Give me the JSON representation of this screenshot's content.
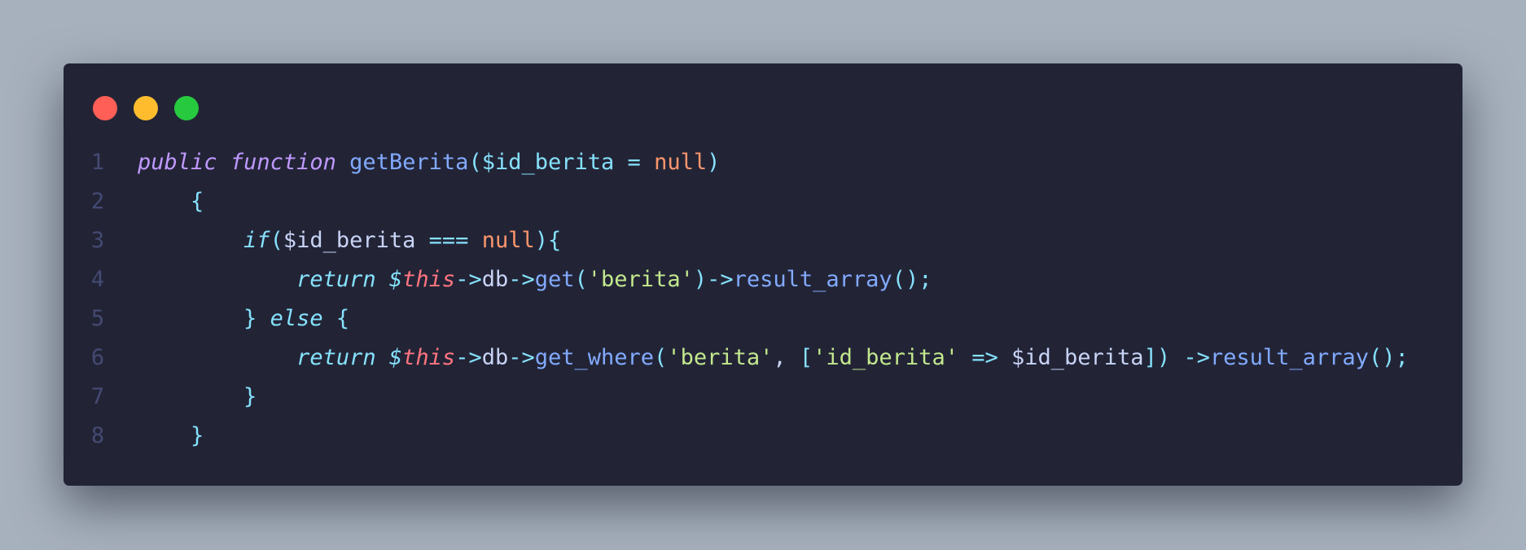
{
  "window": {
    "colors": {
      "close": "#ff5f56",
      "minimize": "#ffbd2e",
      "maximize": "#27c93f",
      "background": "#222436"
    }
  },
  "code": {
    "lines": [
      {
        "number": "1",
        "indent": 0,
        "tokens": [
          {
            "t": "public",
            "c": "kw"
          },
          {
            "t": " ",
            "c": "plain"
          },
          {
            "t": "function",
            "c": "kw"
          },
          {
            "t": " ",
            "c": "plain"
          },
          {
            "t": "getBerita",
            "c": "fn"
          },
          {
            "t": "(",
            "c": "punc"
          },
          {
            "t": "$id_berita",
            "c": "var"
          },
          {
            "t": " ",
            "c": "plain"
          },
          {
            "t": "=",
            "c": "op"
          },
          {
            "t": " ",
            "c": "plain"
          },
          {
            "t": "null",
            "c": "nul"
          },
          {
            "t": ")",
            "c": "punc"
          }
        ]
      },
      {
        "number": "2",
        "indent": 4,
        "tokens": [
          {
            "t": "{",
            "c": "punc"
          }
        ]
      },
      {
        "number": "3",
        "indent": 8,
        "tokens": [
          {
            "t": "if",
            "c": "kw2"
          },
          {
            "t": "(",
            "c": "punc"
          },
          {
            "t": "$id_berita",
            "c": "plain"
          },
          {
            "t": " ",
            "c": "plain"
          },
          {
            "t": "===",
            "c": "op"
          },
          {
            "t": " ",
            "c": "plain"
          },
          {
            "t": "null",
            "c": "nul"
          },
          {
            "t": "){",
            "c": "punc"
          }
        ]
      },
      {
        "number": "4",
        "indent": 12,
        "tokens": [
          {
            "t": "return",
            "c": "kw2"
          },
          {
            "t": " ",
            "c": "plain"
          },
          {
            "t": "$",
            "c": "kw2"
          },
          {
            "t": "this",
            "c": "this"
          },
          {
            "t": "->",
            "c": "op"
          },
          {
            "t": "db",
            "c": "plain"
          },
          {
            "t": "->",
            "c": "op"
          },
          {
            "t": "get",
            "c": "fn"
          },
          {
            "t": "(",
            "c": "punc"
          },
          {
            "t": "'berita'",
            "c": "str"
          },
          {
            "t": ")",
            "c": "punc"
          },
          {
            "t": "->",
            "c": "op"
          },
          {
            "t": "result_array",
            "c": "fn"
          },
          {
            "t": "();",
            "c": "punc"
          }
        ]
      },
      {
        "number": "5",
        "indent": 8,
        "tokens": [
          {
            "t": "}",
            "c": "punc"
          },
          {
            "t": " ",
            "c": "plain"
          },
          {
            "t": "else",
            "c": "kw2"
          },
          {
            "t": " ",
            "c": "plain"
          },
          {
            "t": "{",
            "c": "punc"
          }
        ]
      },
      {
        "number": "6",
        "indent": 12,
        "tokens": [
          {
            "t": "return",
            "c": "kw2"
          },
          {
            "t": " ",
            "c": "plain"
          },
          {
            "t": "$",
            "c": "kw2"
          },
          {
            "t": "this",
            "c": "this"
          },
          {
            "t": "->",
            "c": "op"
          },
          {
            "t": "db",
            "c": "plain"
          },
          {
            "t": "->",
            "c": "op"
          },
          {
            "t": "get_where",
            "c": "fn"
          },
          {
            "t": "(",
            "c": "punc"
          },
          {
            "t": "'berita'",
            "c": "str"
          },
          {
            "t": ", ",
            "c": "plain"
          },
          {
            "t": "[",
            "c": "punc"
          },
          {
            "t": "'id_berita'",
            "c": "str"
          },
          {
            "t": " ",
            "c": "plain"
          },
          {
            "t": "=>",
            "c": "op"
          },
          {
            "t": " ",
            "c": "plain"
          },
          {
            "t": "$id_berita",
            "c": "plain"
          },
          {
            "t": "])",
            "c": "punc"
          },
          {
            "t": " ",
            "c": "plain"
          },
          {
            "t": "->",
            "c": "op"
          },
          {
            "t": "result_array",
            "c": "fn"
          },
          {
            "t": "();",
            "c": "punc"
          }
        ]
      },
      {
        "number": "7",
        "indent": 8,
        "tokens": [
          {
            "t": "}",
            "c": "punc"
          }
        ]
      },
      {
        "number": "8",
        "indent": 4,
        "tokens": [
          {
            "t": "}",
            "c": "punc"
          }
        ]
      }
    ]
  }
}
